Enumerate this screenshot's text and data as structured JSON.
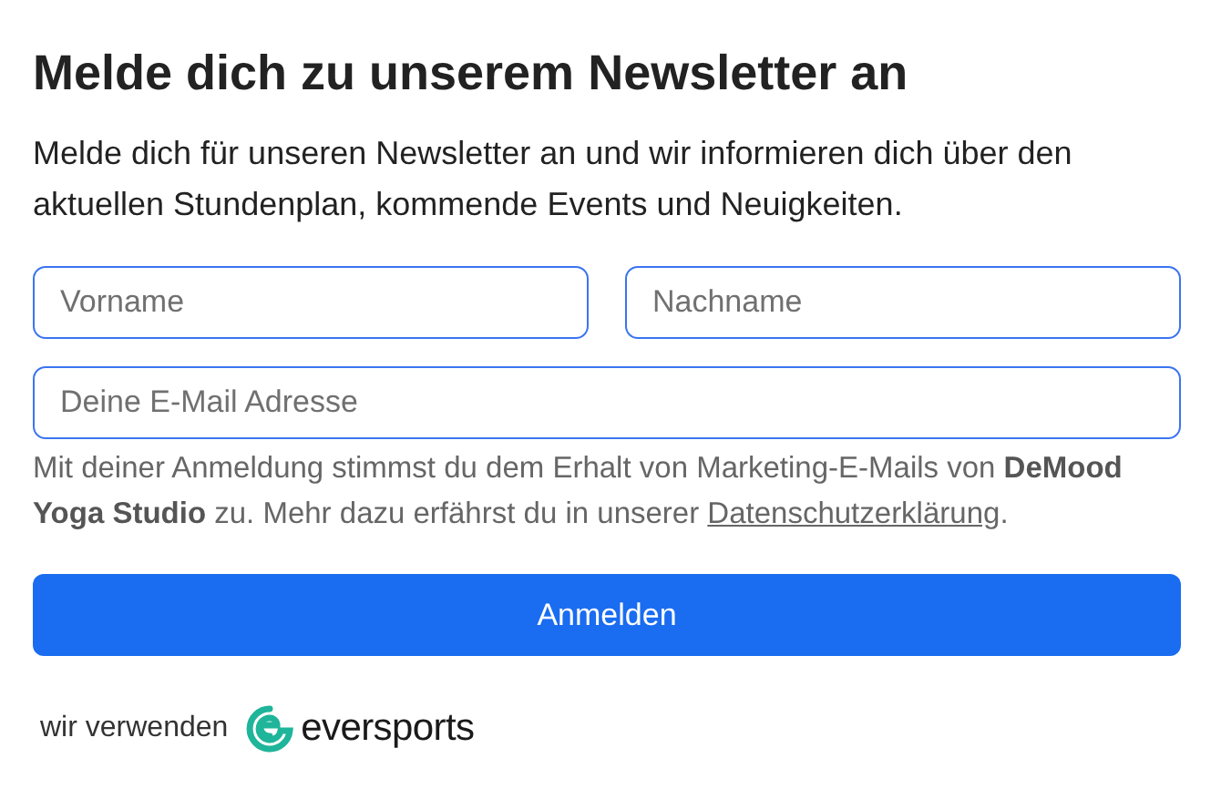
{
  "title": "Melde dich zu unserem Newsletter an",
  "intro": "Melde dich für unseren Newsletter an und wir informieren dich über den aktuellen Stundenplan, kommende Events und Neuigkeiten.",
  "fields": [
    {
      "placeholder": "Vorname"
    },
    {
      "placeholder": "Nachname"
    },
    {
      "placeholder": "Deine E-Mail Adresse"
    }
  ],
  "consent": {
    "text": "Mit deiner Anmeldung stimmst du dem Erhalt von Marketing-E-Mails von **DeMood Yoga Studio** zu. Mehr dazu erfährst du in unserer ",
    "link": "Datenschutzerklärung",
    "end": "."
  },
  "submit_button": "Anmelden",
  "footer": {
    "label": "wir verwenden",
    "brand": "eversports"
  }
}
